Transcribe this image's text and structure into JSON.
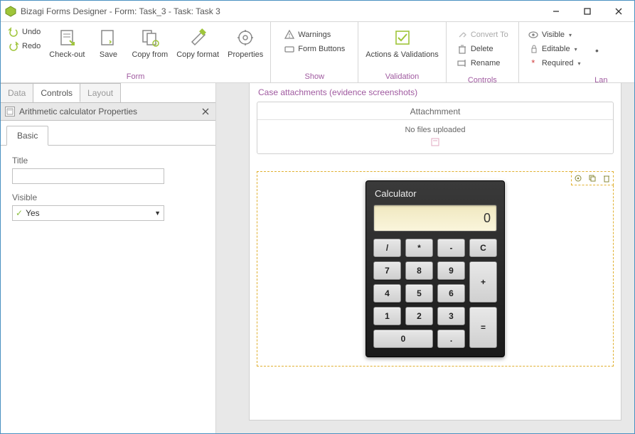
{
  "window": {
    "title": "Bizagi Forms Designer  - Form: Task_3 - Task:  Task 3",
    "controls": {
      "min": "—",
      "max": "▢",
      "close": "✕"
    }
  },
  "ribbon": {
    "undo": "Undo",
    "redo": "Redo",
    "checkout": "Check-out",
    "save": "Save",
    "copyfrom": "Copy from",
    "copyformat": "Copy format",
    "properties": "Properties",
    "group_form": "Form",
    "warnings": "Warnings",
    "formbuttons": "Form Buttons",
    "group_show": "Show",
    "actions": "Actions & Validations",
    "group_validation": "Validation",
    "convertto": "Convert To",
    "delete": "Delete",
    "rename": "Rename",
    "group_controls": "Controls",
    "visible": "Visible",
    "editable": "Editable",
    "required": "Required",
    "lan": "Lan"
  },
  "sidebar": {
    "tabs": {
      "data": "Data",
      "controls": "Controls",
      "layout": "Layout"
    },
    "prop_header": "Arithmetic calculator Properties",
    "prop_tab_basic": "Basic",
    "field_title_label": "Title",
    "field_title_value": "",
    "field_visible_label": "Visible",
    "field_visible_value": "Yes"
  },
  "canvas": {
    "section_title": "Case attachments (evidence screenshots)",
    "attach_header": "Attachmment",
    "attach_empty": "No files uploaded"
  },
  "calculator": {
    "title": "Calculator",
    "display": "0",
    "keys": {
      "div": "/",
      "mul": "*",
      "sub": "-",
      "clr": "C",
      "k7": "7",
      "k8": "8",
      "k9": "9",
      "add": "+",
      "k4": "4",
      "k5": "5",
      "k6": "6",
      "k1": "1",
      "k2": "2",
      "k3": "3",
      "eq": "=",
      "k0": "0",
      "dot": "."
    }
  }
}
